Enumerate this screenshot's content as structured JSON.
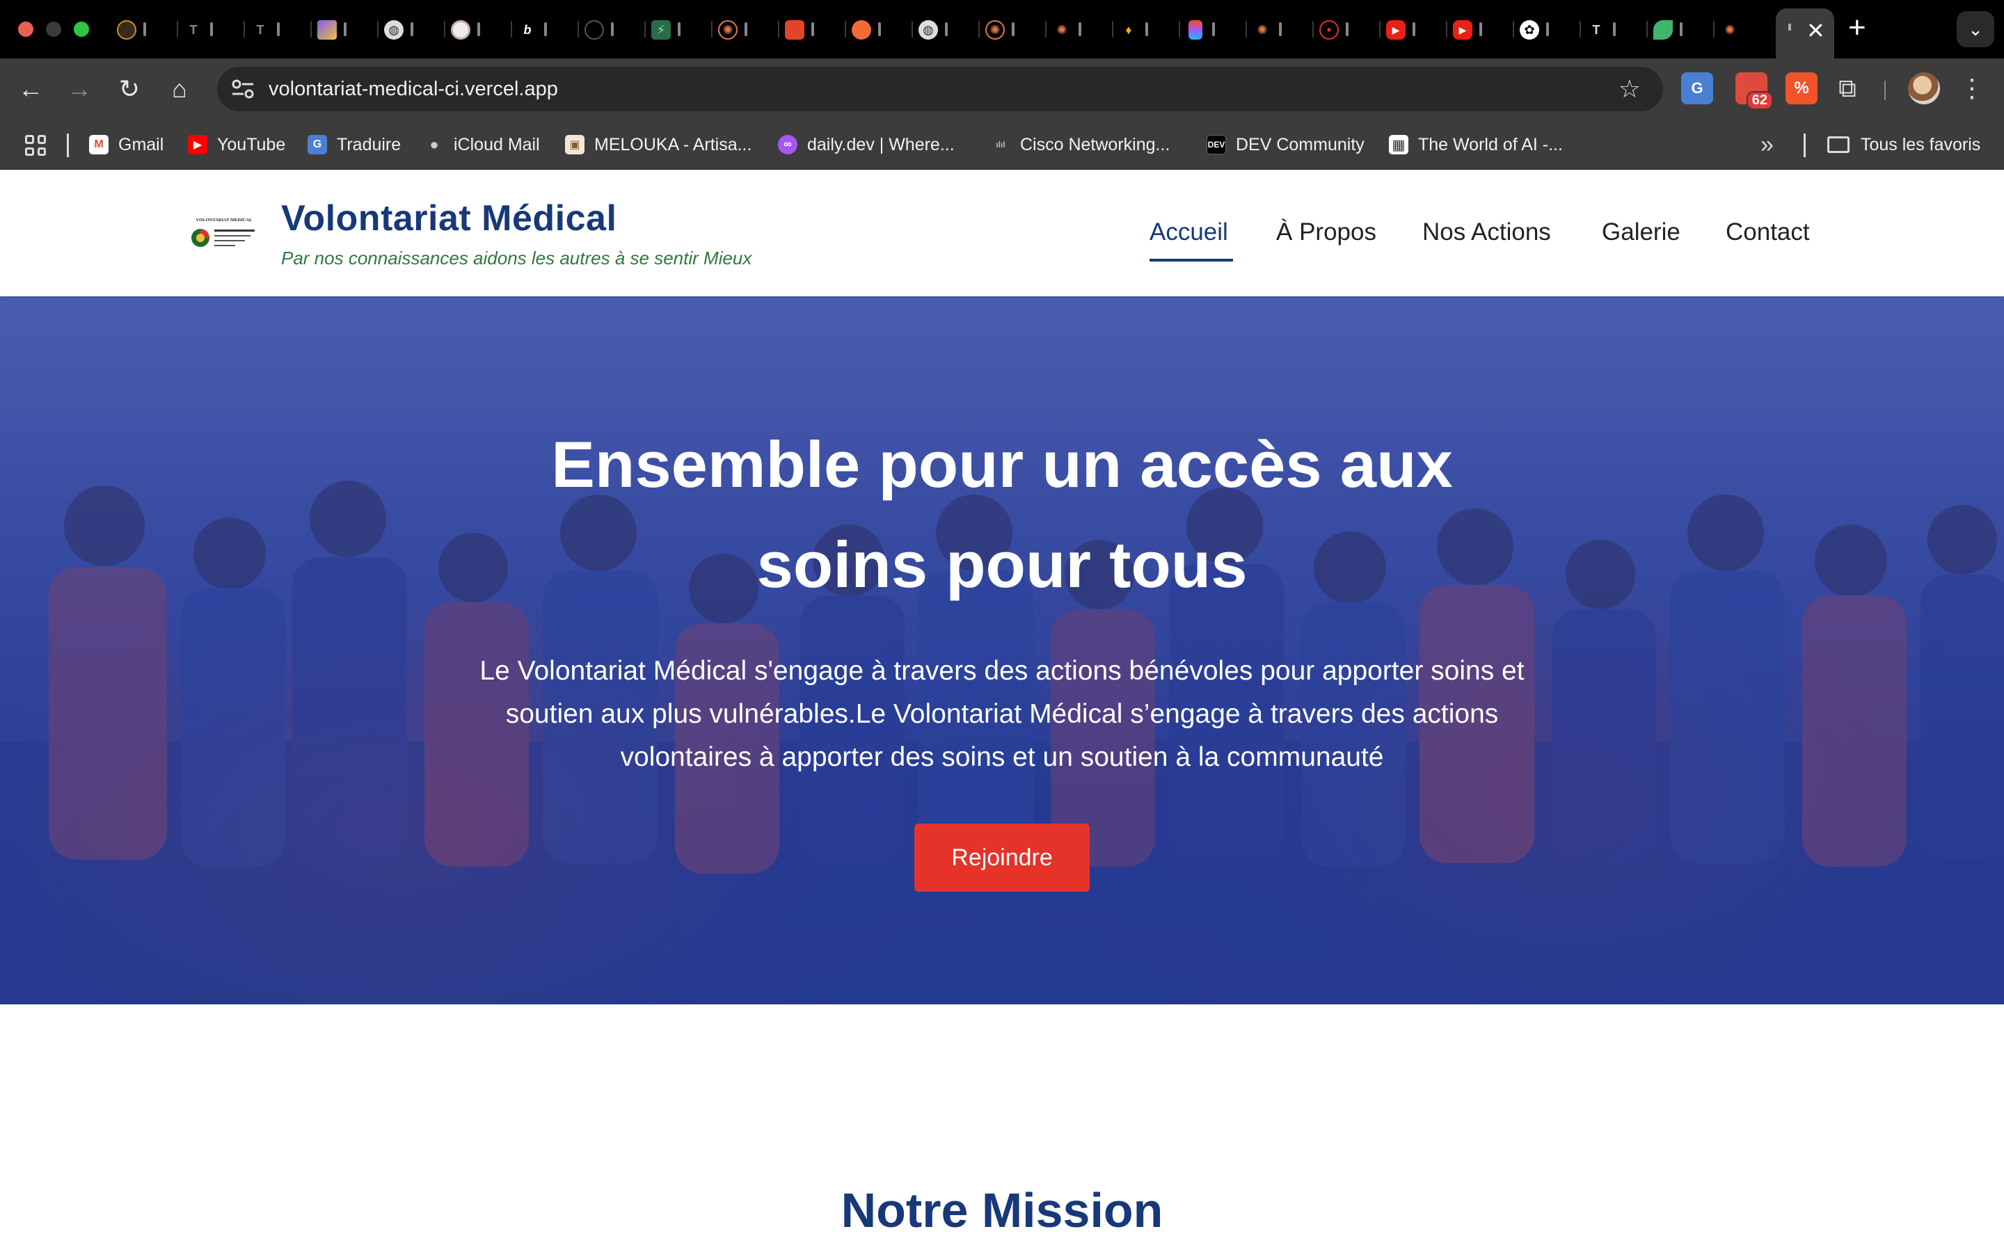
{
  "browser": {
    "url": "volontariat-medical-ci.vercel.app",
    "bookmarks": [
      {
        "label": "Gmail",
        "icon": "gmail-icon"
      },
      {
        "label": "YouTube",
        "icon": "youtube-icon"
      },
      {
        "label": "Traduire",
        "icon": "translate-icon"
      },
      {
        "label": "iCloud Mail",
        "icon": "apple-icon"
      },
      {
        "label": "MELOUKA - Artisa...",
        "icon": "melouka-icon"
      },
      {
        "label": "daily.dev | Where...",
        "icon": "dailydev-icon"
      },
      {
        "label": "Cisco Networking...",
        "icon": "cisco-icon"
      },
      {
        "label": "DEV Community",
        "icon": "dev-icon"
      },
      {
        "label": "The World of AI -...",
        "icon": "grid-icon"
      }
    ],
    "all_bookmarks_label": "Tous les favoris",
    "mail_badge": "62",
    "colors": {
      "chrome_dark": "#3c3c3c",
      "tabstrip": "#000000"
    }
  },
  "site": {
    "brand_title": "Volontariat Médical",
    "tagline": "Par nos connaissances aidons les autres à se sentir Mieux",
    "logo_text": "VOLONTARIAT MEDICAL",
    "nav": [
      {
        "label": "Accueil",
        "active": true
      },
      {
        "label": "À Propos",
        "active": false
      },
      {
        "label": "Nos Actions",
        "active": false
      },
      {
        "label": "Galerie",
        "active": false
      },
      {
        "label": "Contact",
        "active": false
      }
    ],
    "colors": {
      "primary": "#17397a",
      "accent": "#e5332a",
      "tagline": "#2e7a3b"
    }
  },
  "hero": {
    "title_line1": "Ensemble pour un accès aux",
    "title_line2": "soins pour tous",
    "text_line1": "Le Volontariat Médical s'engage à travers des actions bénévoles pour apporter soins et",
    "text_line2": "soutien aux plus vulnérables.Le Volontariat Médical s’engage à travers des actions",
    "text_line3": "volontaires à apporter des soins et un soutien à la communauté",
    "cta_label": "Rejoindre"
  },
  "mission": {
    "title": "Notre Mission"
  }
}
